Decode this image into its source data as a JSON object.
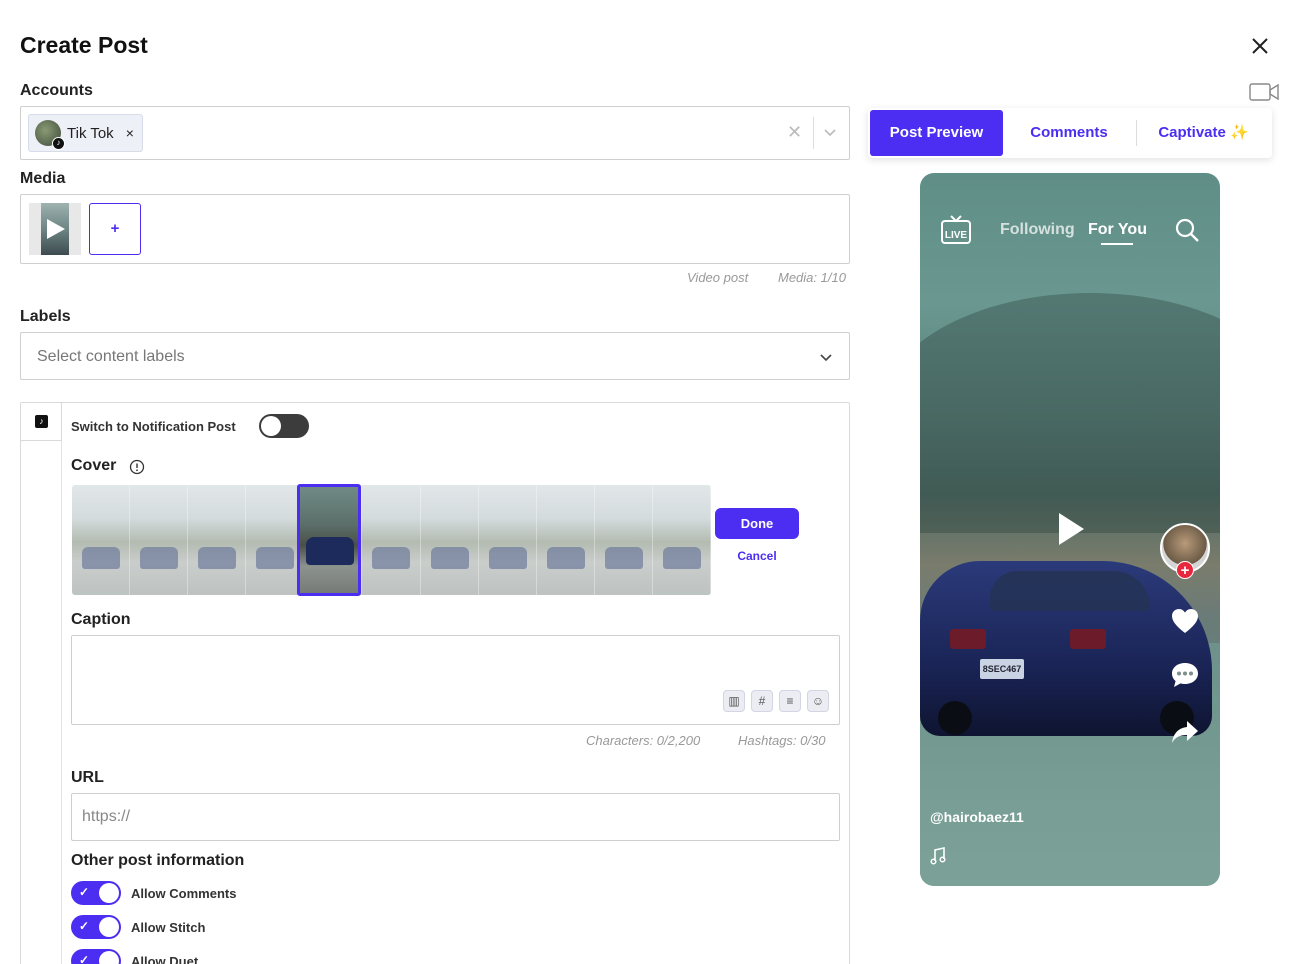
{
  "header": {
    "title": "Create Post"
  },
  "accounts": {
    "label": "Accounts",
    "chips": [
      {
        "name": "Tik Tok",
        "remove": "×"
      }
    ]
  },
  "media": {
    "label": "Media",
    "add_label": "+",
    "post_type": "Video post",
    "count": "Media: 1/10"
  },
  "labels": {
    "label": "Labels",
    "placeholder": "Select content labels"
  },
  "tiktok": {
    "notification_label": "Switch to Notification Post",
    "cover_label": "Cover",
    "done_label": "Done",
    "cancel_label": "Cancel",
    "caption_label": "Caption",
    "characters": "Characters: 0/2,200",
    "hashtags": "Hashtags: 0/30",
    "url_label": "URL",
    "url_placeholder": "https://",
    "other_info_label": "Other post information",
    "toggles": [
      {
        "label": "Allow Comments",
        "on": true
      },
      {
        "label": "Allow Stitch",
        "on": true
      },
      {
        "label": "Allow Duet",
        "on": true
      }
    ]
  },
  "preview_tabs": {
    "active": "Post Preview",
    "comments": "Comments",
    "captivate": "Captivate ✨"
  },
  "phone": {
    "following": "Following",
    "for_you": "For You",
    "username": "@hairobaez11",
    "plate": "8SEC467"
  },
  "colors": {
    "accent": "#4b2ef2",
    "follow_red": "#e8273c"
  }
}
